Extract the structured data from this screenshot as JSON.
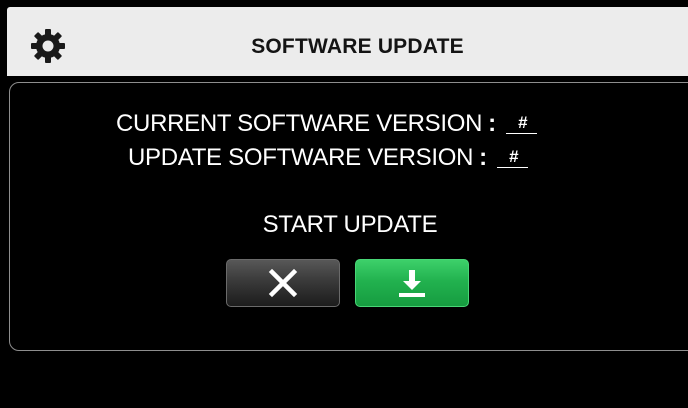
{
  "header": {
    "title": "SOFTWARE UPDATE",
    "icon": "gear-icon"
  },
  "panel": {
    "current_version_label": "CURRENT SOFTWARE VERSION",
    "current_version_value": "#",
    "update_version_label": "UPDATE SOFTWARE VERSION",
    "update_version_value": "#",
    "separator": ":",
    "start_update_label": "START UPDATE"
  },
  "buttons": {
    "cancel_icon": "close-icon",
    "confirm_icon": "download-icon"
  },
  "colors": {
    "header_bg": "#ececec",
    "screen_bg": "#000000",
    "confirm_green": "#22b24f",
    "cancel_dark": "#3a3a3a"
  }
}
